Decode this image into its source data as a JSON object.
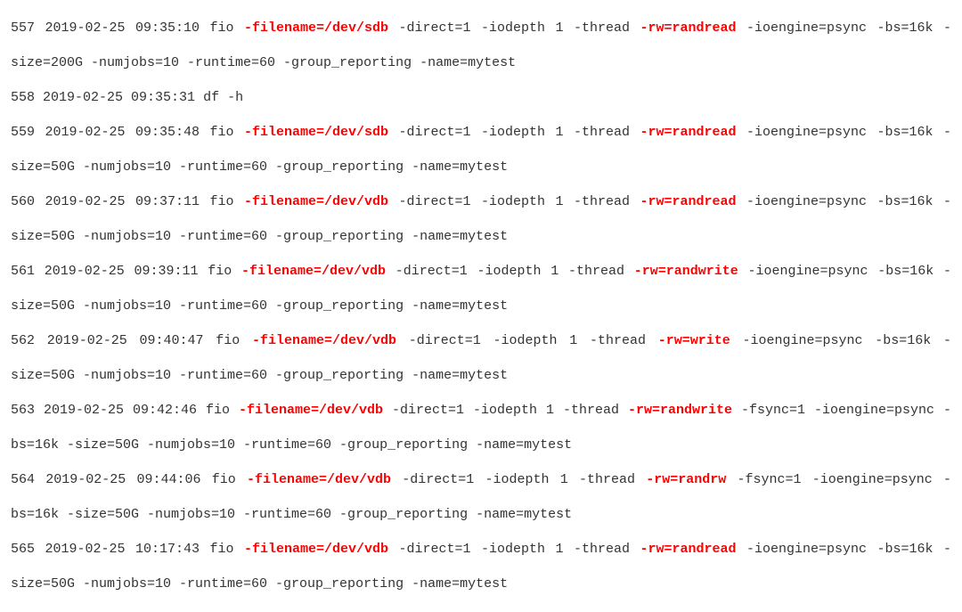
{
  "entries": [
    {
      "num": "557",
      "ts": "2019-02-25 09:35:10",
      "cmd": "fio",
      "segments": [
        {
          "t": "fio ",
          "r": false
        },
        {
          "t": "-filename=/dev/sdb",
          "r": true
        },
        {
          "t": " -direct=1 -iodepth 1 -thread ",
          "r": false
        },
        {
          "t": "-rw=randread",
          "r": true
        },
        {
          "t": " -ioengine=psync -bs=16k -size=200G -numjobs=10 -runtime=60 -group_reporting -name=mytest",
          "r": false
        }
      ]
    },
    {
      "num": "558",
      "ts": "2019-02-25 09:35:31",
      "cmd": "df",
      "segments": [
        {
          "t": "df -h",
          "r": false
        }
      ]
    },
    {
      "num": "559",
      "ts": "2019-02-25 09:35:48",
      "cmd": "fio",
      "segments": [
        {
          "t": "fio ",
          "r": false
        },
        {
          "t": "-filename=/dev/sdb",
          "r": true
        },
        {
          "t": " -direct=1 -iodepth 1 -thread ",
          "r": false
        },
        {
          "t": "-rw=randread",
          "r": true
        },
        {
          "t": " -ioengine=psync -bs=16k -size=50G -numjobs=10 -runtime=60 -group_reporting -name=mytest",
          "r": false
        }
      ]
    },
    {
      "num": "560",
      "ts": "2019-02-25 09:37:11",
      "cmd": "fio",
      "segments": [
        {
          "t": "fio ",
          "r": false
        },
        {
          "t": "-filename=/dev/vdb",
          "r": true
        },
        {
          "t": " -direct=1 -iodepth 1 -thread ",
          "r": false
        },
        {
          "t": "-rw=randread",
          "r": true
        },
        {
          "t": " -ioengine=psync -bs=16k -size=50G -numjobs=10 -runtime=60 -group_reporting -name=mytest",
          "r": false
        }
      ]
    },
    {
      "num": "561",
      "ts": "2019-02-25 09:39:11",
      "cmd": "fio",
      "segments": [
        {
          "t": "fio ",
          "r": false
        },
        {
          "t": "-filename=/dev/vdb",
          "r": true
        },
        {
          "t": " -direct=1 -iodepth 1 -thread ",
          "r": false
        },
        {
          "t": "-rw=randwrite",
          "r": true
        },
        {
          "t": " -ioengine=psync -bs=16k -size=50G -numjobs=10 -runtime=60 -group_reporting -name=mytest",
          "r": false
        }
      ]
    },
    {
      "num": "562",
      "ts": "2019-02-25 09:40:47",
      "cmd": "fio",
      "segments": [
        {
          "t": "fio ",
          "r": false
        },
        {
          "t": "-filename=/dev/vdb",
          "r": true
        },
        {
          "t": " -direct=1 -iodepth 1 -thread ",
          "r": false
        },
        {
          "t": "-rw=write",
          "r": true
        },
        {
          "t": " -ioengine=psync -bs=16k -size=50G -numjobs=10 -runtime=60 -group_reporting -name=mytest",
          "r": false
        }
      ]
    },
    {
      "num": "563",
      "ts": "2019-02-25 09:42:46",
      "cmd": "fio",
      "segments": [
        {
          "t": "fio ",
          "r": false
        },
        {
          "t": "-filename=/dev/vdb",
          "r": true
        },
        {
          "t": " -direct=1 -iodepth 1 -thread ",
          "r": false
        },
        {
          "t": "-rw=randwrite",
          "r": true
        },
        {
          "t": " -fsync=1 -ioengine=psync -bs=16k -size=50G -numjobs=10 -runtime=60 -group_reporting -name=mytest",
          "r": false
        }
      ]
    },
    {
      "num": "564",
      "ts": "2019-02-25 09:44:06",
      "cmd": "fio",
      "segments": [
        {
          "t": "fio ",
          "r": false
        },
        {
          "t": "-filename=/dev/vdb",
          "r": true
        },
        {
          "t": " -direct=1 -iodepth 1 -thread ",
          "r": false
        },
        {
          "t": "-rw=randrw",
          "r": true
        },
        {
          "t": " -fsync=1 -ioengine=psync -bs=16k -size=50G -numjobs=10 -runtime=60 -group_reporting -name=mytest",
          "r": false
        }
      ]
    },
    {
      "num": "565",
      "ts": "2019-02-25 10:17:43",
      "cmd": "fio",
      "segments": [
        {
          "t": "fio ",
          "r": false
        },
        {
          "t": "-filename=/dev/vdb",
          "r": true
        },
        {
          "t": " -direct=1 -iodepth 1 -thread ",
          "r": false
        },
        {
          "t": "-rw=randread",
          "r": true
        },
        {
          "t": " -ioengine=psync -bs=16k -size=50G -numjobs=10 -runtime=60 -group_reporting -name=mytest",
          "r": false
        }
      ]
    }
  ]
}
